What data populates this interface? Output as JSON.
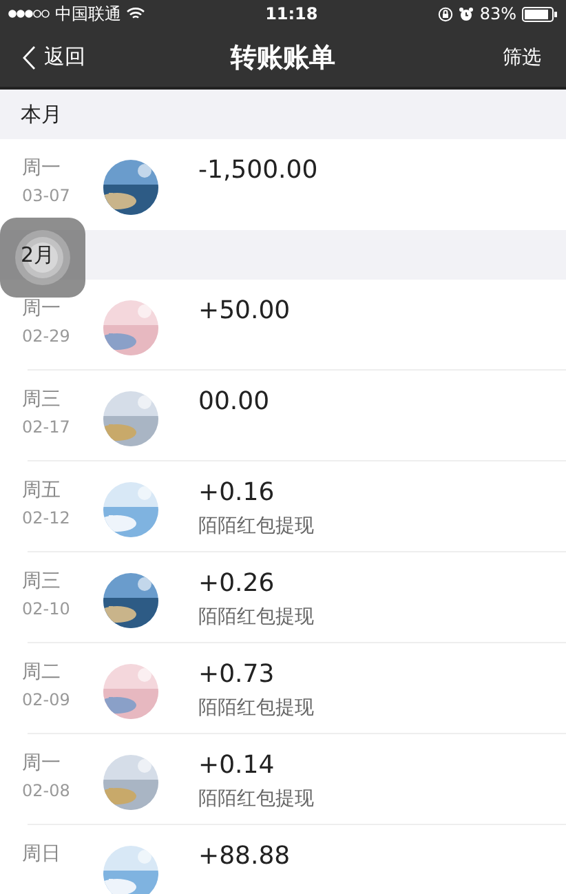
{
  "status_bar": {
    "carrier": "中国联通",
    "time": "11:18",
    "battery": "83%"
  },
  "nav": {
    "back": "返回",
    "title": "转账账单",
    "action": "筛选"
  },
  "sections": [
    {
      "header": "本月",
      "rows": [
        {
          "weekday": "周一",
          "date": "03-07",
          "amount": "-1,500.00"
        }
      ]
    },
    {
      "header": "2月",
      "rows": [
        {
          "weekday": "周一",
          "date": "02-29",
          "amount": "+50.00"
        },
        {
          "weekday": "周三",
          "date": "02-17",
          "amount": "00.00"
        },
        {
          "weekday": "周五",
          "date": "02-12",
          "amount": "+0.16",
          "description": "陌陌红包提现"
        },
        {
          "weekday": "周三",
          "date": "02-10",
          "amount": "+0.26",
          "description": "陌陌红包提现"
        },
        {
          "weekday": "周二",
          "date": "02-09",
          "amount": "+0.73",
          "description": "陌陌红包提现"
        },
        {
          "weekday": "周一",
          "date": "02-08",
          "amount": "+0.14",
          "description": "陌陌红包提现"
        },
        {
          "weekday": "周日",
          "amount": "+88.88"
        }
      ]
    }
  ]
}
